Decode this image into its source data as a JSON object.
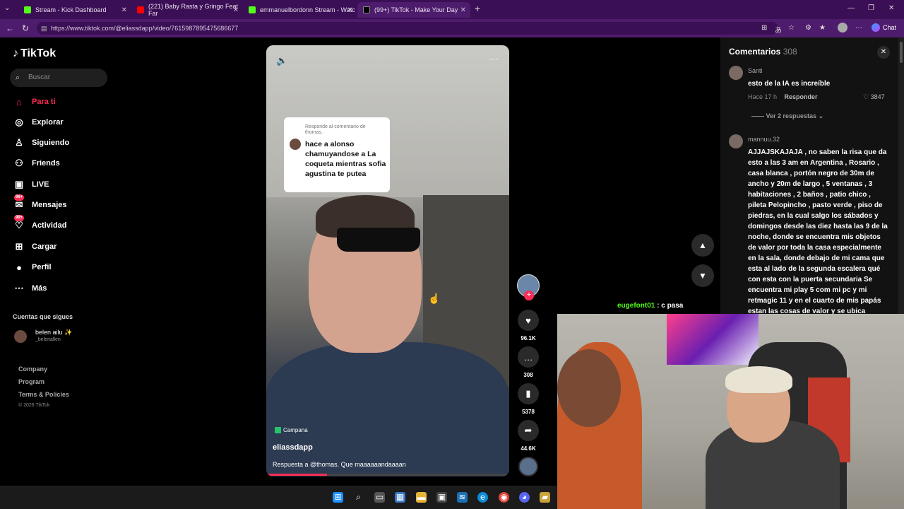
{
  "browser": {
    "tabs": [
      {
        "label": "Stream - Kick Dashboard",
        "favicon_color": "#53fc18"
      },
      {
        "label": "(221) Baby Rasta y Gringo Feat Far",
        "favicon_color": "#ff0000"
      },
      {
        "label": "emmanuelbordonn Stream - Watc",
        "favicon_color": "#53fc18"
      },
      {
        "label": "(99+) TikTok - Make Your Day",
        "favicon_color": "#000000"
      }
    ],
    "url": "https://www.tiktok.com/@eliassdapp/video/7615987895475686677",
    "chat_label": "Chat"
  },
  "tiktok": {
    "logo": "TikTok",
    "search_placeholder": "Buscar",
    "nav": [
      {
        "label": "Para ti",
        "icon": "home-icon",
        "active": true
      },
      {
        "label": "Explorar",
        "icon": "compass-icon"
      },
      {
        "label": "Siguiendo",
        "icon": "following-icon"
      },
      {
        "label": "Friends",
        "icon": "friends-icon"
      },
      {
        "label": "LIVE",
        "icon": "live-icon"
      },
      {
        "label": "Mensajes",
        "icon": "messages-icon",
        "badge": "99+"
      },
      {
        "label": "Actividad",
        "icon": "activity-icon",
        "badge": "99+"
      },
      {
        "label": "Cargar",
        "icon": "upload-icon"
      },
      {
        "label": "Perfil",
        "icon": "profile-icon"
      },
      {
        "label": "Más",
        "icon": "more-icon"
      }
    ],
    "following_title": "Cuentas que sigues",
    "following": [
      {
        "name": "belen ailu ✨",
        "handle": "_belenallen"
      }
    ],
    "footer": [
      "Company",
      "Program",
      "Terms & Policies"
    ],
    "copyright": "© 2026 TikTok"
  },
  "video": {
    "reply_header": "Responde al comentario de thomas.",
    "reply_text": "hace a alonso chamuyandose a La coqueta mientras sofia agustina te putea",
    "campaign": "Campana",
    "author": "eliassdapp",
    "caption": "Respuesta a @thomas. Que maaaaaandaaaan",
    "progress": 0.25,
    "likes": "96.1K",
    "comments": "308",
    "saves": "5378",
    "shares": "44.6K"
  },
  "comments_panel": {
    "title": "Comentarios",
    "count": "308",
    "items": [
      {
        "user": "Santi",
        "text": "esto de la IA es increíble",
        "time": "Hace 17 h",
        "reply_label": "Responder",
        "likes": "3847",
        "view_replies": "Ver 2 respuestas"
      },
      {
        "user": "mannuu.32",
        "text": "AJJAJSKAJAJA , no saben la risa que da esto a las 3 am en Argentina , Rosario , casa blanca , portón negro de 30m de ancho y 20m de largo , 5 ventanas , 3 habitaciones , 2 baños , patio chico , pileta Pelopincho , pasto verde , piso de piedras, en la cual salgo los sábados y domingos desde las diez hasta las 9 de la noche, donde se encuentra mis objetos de valor por toda la casa especialmente en la sala, donde debajo de mi cama que esta al lado de la segunda escalera qué con esta con la puerta secundaria Se encuentra mi play 5 com mi pc y mi retmagic 11 y en el cuarto de mis papás estan las cosas de valor y se ubica"
      }
    ]
  },
  "stream_chat": {
    "user": "eugefont01",
    "message": ": c pasa"
  }
}
